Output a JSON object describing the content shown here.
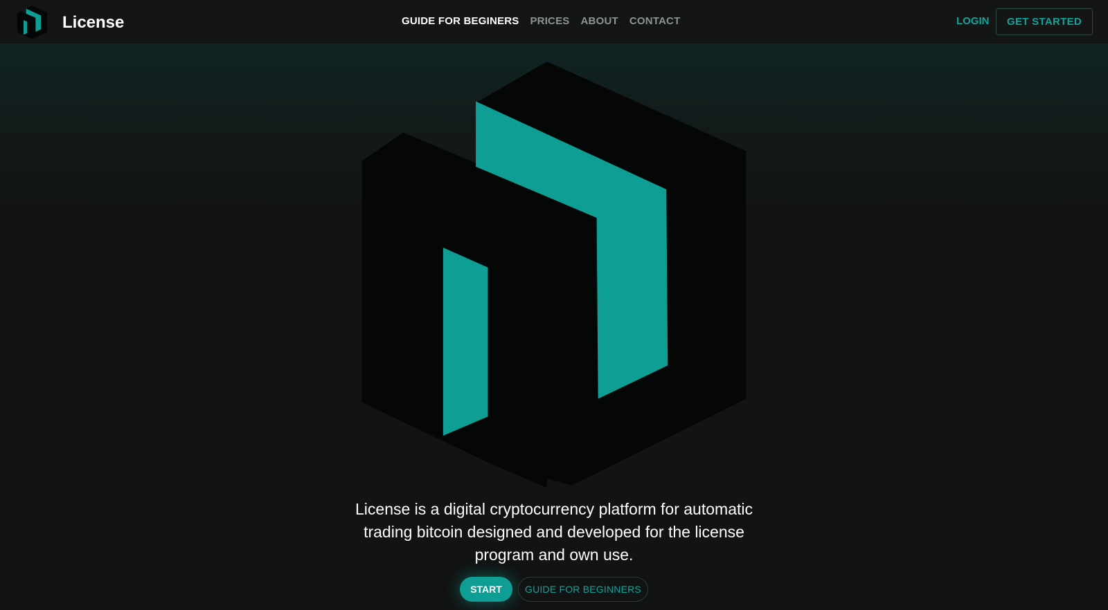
{
  "brand": {
    "name": "License",
    "logo_icon": "license-logo-icon"
  },
  "nav": {
    "links": [
      {
        "label": "GUIDE FOR BEGINERS",
        "active": true
      },
      {
        "label": "PRICES",
        "active": false
      },
      {
        "label": "ABOUT",
        "active": false
      },
      {
        "label": "CONTACT",
        "active": false
      }
    ],
    "login_label": "LOGIN",
    "get_started_label": "GET STARTED"
  },
  "hero": {
    "tagline": "License is a digital cryptocurrency platform for automatic trading bitcoin designed and developed for the license program and own use.",
    "start_label": "START",
    "guide_label": "GUIDE FOR BEGINNERS"
  },
  "colors": {
    "background": "#121313",
    "navbar": "#141515",
    "accent": "#0e9e94",
    "accent_text": "#14a39a",
    "logo_dark": "#050606",
    "muted_text": "#8e9393"
  }
}
